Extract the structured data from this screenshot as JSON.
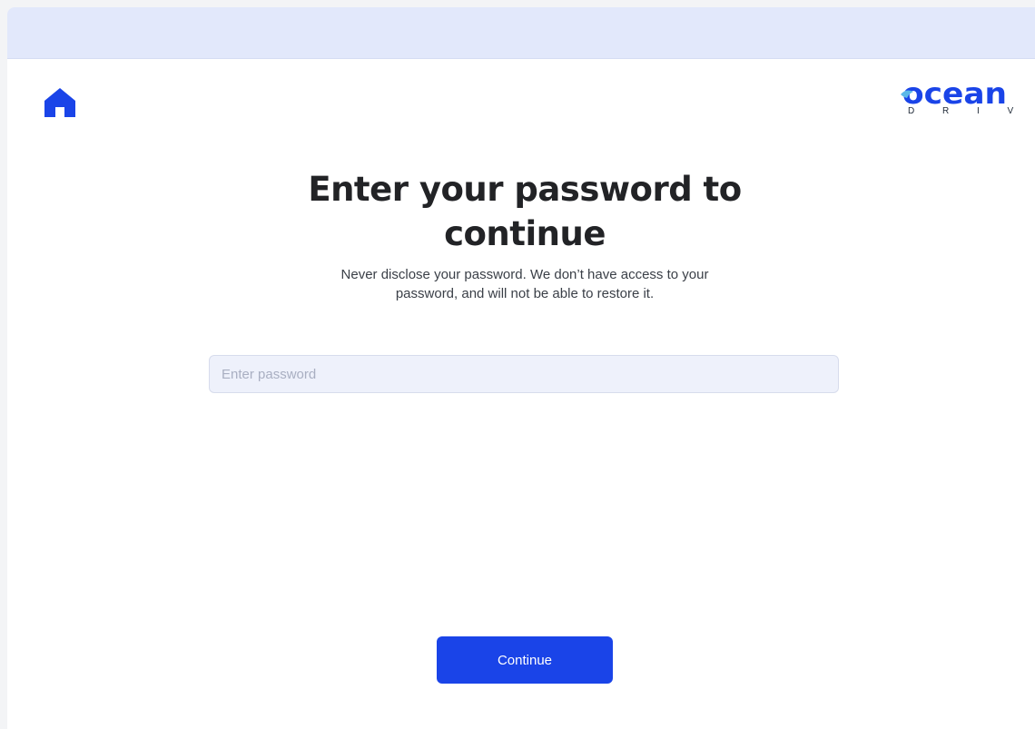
{
  "header": {
    "home_icon": "home-icon"
  },
  "brand": {
    "wordmark": "ocean",
    "subtitle": "D R I V E",
    "color": "#1a44e8"
  },
  "main": {
    "heading": "Enter your password to continue",
    "subtext": "Never disclose your password. We don’t have access to your password, and will not be able to restore it.",
    "password": {
      "placeholder": "Enter password",
      "value": ""
    },
    "continue_label": "Continue"
  },
  "colors": {
    "accent": "#1a44e8",
    "topbar": "#e2e8fb",
    "input_bg": "#eef1fb",
    "heading": "#222326"
  }
}
